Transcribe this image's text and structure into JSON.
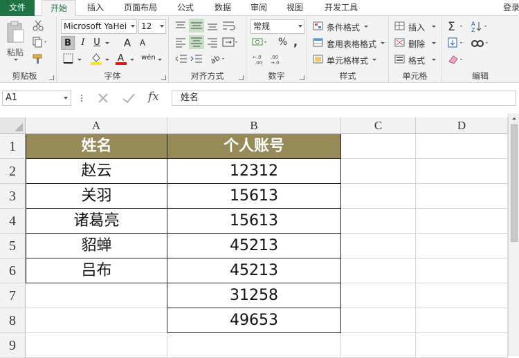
{
  "menu": {
    "tabs": [
      {
        "label": "文件"
      },
      {
        "label": "开始"
      },
      {
        "label": "插入"
      },
      {
        "label": "页面布局"
      },
      {
        "label": "公式"
      },
      {
        "label": "数据"
      },
      {
        "label": "审阅"
      },
      {
        "label": "视图"
      },
      {
        "label": "开发工具"
      }
    ],
    "login": "登录",
    "active_tab": "开始"
  },
  "ribbon": {
    "clipboard": {
      "paste": "粘贴",
      "label": "剪贴板"
    },
    "font": {
      "name": "Microsoft YaHei",
      "size": "12",
      "bold": "B",
      "italic": "I",
      "underline": "U",
      "grow": "A",
      "shrink": "A",
      "phonetic": "wén",
      "label": "字体"
    },
    "alignment": {
      "label": "对齐方式"
    },
    "number": {
      "format": "常规",
      "percent": "%",
      "comma": ",",
      "label": "数字"
    },
    "styles": {
      "conditional": "条件格式",
      "table": "套用表格格式",
      "cell": "单元格样式",
      "label": "样式"
    },
    "cells": {
      "insert": "插入",
      "delete": "删除",
      "format": "格式",
      "label": "单元格"
    },
    "editing": {
      "label": "编辑"
    }
  },
  "formula_bar": {
    "name_box": "A1",
    "formula": "姓名",
    "fx": "fx"
  },
  "sheet": {
    "columns": [
      "A",
      "B",
      "C",
      "D"
    ],
    "rows": [
      "1",
      "2",
      "3",
      "4",
      "5",
      "6",
      "7",
      "8",
      "9"
    ],
    "header_row": [
      "姓名",
      "个人账号"
    ],
    "data": [
      [
        "赵云",
        "12312"
      ],
      [
        "关羽",
        "15613"
      ],
      [
        "诸葛亮",
        "15613"
      ],
      [
        "貂蝉",
        "45213"
      ],
      [
        "吕布",
        "45213"
      ],
      [
        "",
        "31258"
      ],
      [
        "",
        "49653"
      ]
    ]
  },
  "colors": {
    "header_fill": "#958a58",
    "excel_green": "#217346",
    "ribbon_bg": "#f3f3f3"
  }
}
